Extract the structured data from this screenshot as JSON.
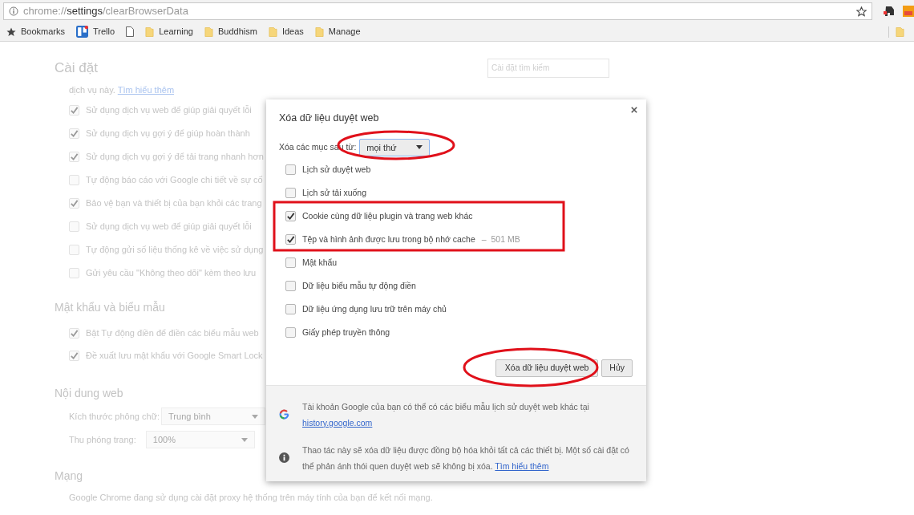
{
  "address_bar": {
    "scheme": "chrome://",
    "host": "settings",
    "path": "/clearBrowserData"
  },
  "bookmarks": [
    {
      "kind": "star",
      "label": "Bookmarks"
    },
    {
      "kind": "trello",
      "label": "Trello"
    },
    {
      "kind": "page"
    },
    {
      "kind": "folder",
      "label": "Learning"
    },
    {
      "kind": "folder",
      "label": "Buddhism"
    },
    {
      "kind": "folder",
      "label": "Ideas"
    },
    {
      "kind": "folder",
      "label": "Manage"
    }
  ],
  "settings": {
    "title": "Cài đặt",
    "search_placeholder": "Cài đặt tìm kiếm",
    "intro": "dịch vụ này.",
    "intro_link": "Tìm hiểu thêm",
    "privacy_options": [
      {
        "label": "Sử dụng dịch vụ web để giúp giải quyết lỗi",
        "checked": true
      },
      {
        "label": "Sử dụng dịch vụ gợi ý để giúp hoàn thành",
        "checked": true
      },
      {
        "label": "Sử dụng dịch vụ gợi ý để tải trang nhanh hơn",
        "checked": true
      },
      {
        "label": "Tự động báo cáo với Google chi tiết về sự cố",
        "checked": false
      },
      {
        "label": "Bảo vệ bạn và thiết bị của bạn khỏi các trang",
        "checked": true
      },
      {
        "label": "Sử dụng dịch vụ web để giúp giải quyết lỗi",
        "checked": false
      },
      {
        "label": "Tự động gửi số liệu thống kê về việc sử dụng",
        "checked": false
      },
      {
        "label": "Gửi yêu cầu \"Không theo dõi\" kèm theo lưu",
        "checked": false
      }
    ],
    "passwords": {
      "heading": "Mật khẩu và biểu mẫu",
      "options": [
        {
          "label": "Bật Tự động điền để điền các biểu mẫu web",
          "checked": true
        },
        {
          "label": "Đề xuất lưu mật khẩu với Google Smart Lock",
          "checked": true
        }
      ]
    },
    "web_content": {
      "heading": "Nội dung web",
      "font_size_label": "Kích thước phông chữ:",
      "font_size_value": "Trung bình",
      "zoom_label": "Thu phóng trang:",
      "zoom_value": "100%"
    },
    "network": {
      "heading": "Mạng",
      "text": "Google Chrome đang sử dụng cài đặt proxy hệ thống trên máy tính của bạn để kết nối mạng."
    }
  },
  "dialog": {
    "title": "Xóa dữ liệu duyệt web",
    "range_label": "Xóa các mục sau từ:",
    "range_value": "mọi thứ",
    "items": [
      {
        "label": "Lịch sử duyệt web",
        "checked": false
      },
      {
        "label": "Lịch sử tải xuống",
        "checked": false
      },
      {
        "label": "Cookie cùng dữ liệu plugin và trang web khác",
        "checked": true
      },
      {
        "label": "Tệp và hình ảnh được lưu trong bộ nhớ cache",
        "size_separator": "–",
        "size": "501 MB",
        "checked": true
      },
      {
        "label": "Mật khẩu",
        "checked": false
      },
      {
        "label": "Dữ liệu biểu mẫu tự động điền",
        "checked": false
      },
      {
        "label": "Dữ liệu ứng dụng lưu trữ trên máy chủ",
        "checked": false
      },
      {
        "label": "Giấy phép truyền thông",
        "checked": false
      }
    ],
    "clear_button": "Xóa dữ liệu duyệt web",
    "cancel_button": "Hủy",
    "notes": [
      {
        "kind": "google",
        "text": "Tài khoản Google của bạn có thể có các biểu mẫu lịch sử duyệt web khác tại",
        "link": "history.google.com"
      },
      {
        "kind": "info",
        "text": "Thao tác này sẽ xóa dữ liệu được đồng bộ hóa khỏi tất cả các thiết bị. Một số cài đặt có thể phản ánh thói quen duyệt web sẽ không bị xóa.",
        "link": "Tìm hiểu thêm"
      }
    ]
  }
}
